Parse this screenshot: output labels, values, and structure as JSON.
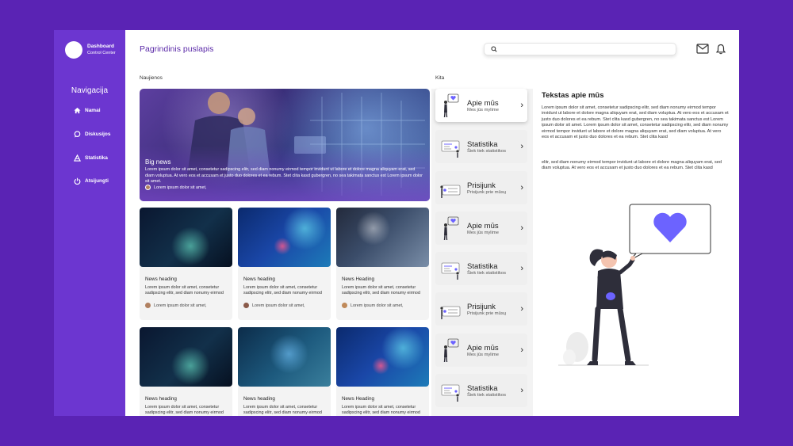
{
  "sidebar": {
    "brand_title": "Dashboard",
    "brand_subtitle": "Control Center",
    "nav_heading": "Navigacija",
    "items": [
      {
        "label": "Namai",
        "icon": "home-icon"
      },
      {
        "label": "Diskusijos",
        "icon": "chat-icon"
      },
      {
        "label": "Statistika",
        "icon": "chart-icon"
      },
      {
        "label": "Atsijungti",
        "icon": "power-icon"
      }
    ]
  },
  "header": {
    "title": "Pagrindinis puslapis",
    "search_placeholder": "",
    "icons": [
      "mail-icon",
      "bell-icon"
    ]
  },
  "news": {
    "section_label": "Naujienos",
    "hero": {
      "title": "Big news",
      "text": "Lorem ipsum dolor sit amet, consetetur sadipscing elitr, sed diam nonumy eirmod tempor invidunt ut labore et dolore magna aliquyam erat, sed diam voluptua. At vero eos et accusam et justo duo dolores et ea rebum. Stet clita kasd gubergren, no sea takimata sanctus est Lorem ipsum dolor sit amet.",
      "author": "Lorem ipsum dolor sit amet,"
    },
    "cards": [
      {
        "heading": "News heading",
        "text": "Lorem ipsum dolor sit amet, consetetur sadipscing elitr, sed diam nonumy eirmod",
        "author": "Lorem ipsum dolor sit amet,"
      },
      {
        "heading": "News heading",
        "text": "Lorem ipsum dolor sit amet, consetetur sadipscing elitr, sed diam nonumy eirmod",
        "author": "Lorem ipsum dolor sit amet,"
      },
      {
        "heading": "News Heading",
        "text": "Lorem ipsum dolor sit amet, consetetur sadipscing elitr, sed diam nonumy eirmod",
        "author": "Lorem ipsum dolor sit amet,"
      },
      {
        "heading": "News heading",
        "text": "Lorem ipsum dolor sit amet, consetetur sadipscing elitr, sed diam nonumy eirmod",
        "author": ""
      },
      {
        "heading": "News heading",
        "text": "Lorem ipsum dolor sit amet, consetetur sadipscing elitr, sed diam nonumy eirmod",
        "author": ""
      },
      {
        "heading": "News Heading",
        "text": "Lorem ipsum dolor sit amet, consetetur sadipscing elitr, sed diam nonumy eirmod",
        "author": ""
      }
    ]
  },
  "kita": {
    "section_label": "Kita",
    "items": [
      {
        "title": "Apie mūs",
        "subtitle": "Mes jūs mylime",
        "active": true
      },
      {
        "title": "Statistika",
        "subtitle": "Šiek tiek statistikos",
        "active": false
      },
      {
        "title": "Prisijunk",
        "subtitle": "Prisijunk prie mūsų",
        "active": false
      },
      {
        "title": "Apie mūs",
        "subtitle": "Mes jūs mylime",
        "active": false
      },
      {
        "title": "Statistika",
        "subtitle": "Šiek tiek statistikos",
        "active": false
      },
      {
        "title": "Prisijunk",
        "subtitle": "Prisijunk prie mūsų",
        "active": false
      },
      {
        "title": "Apie mūs",
        "subtitle": "Mes jūs mylime",
        "active": false
      },
      {
        "title": "Statistika",
        "subtitle": "Šiek tiek statistikos",
        "active": false
      }
    ]
  },
  "about": {
    "title": "Tekstas apie mūs",
    "paragraph1": "Lorem ipsum dolor sit amet, consetetur sadipscing elitr, sed diam nonumy eirmod tempor invidunt ut labore et dolore magna aliquyam erat, sed diam voluptua. At vero eos et accusam et justo duo dolores et ea rebum. Stet clita kasd gubergren, no sea takimata sanctus est Lorem ipsum dolor sit amet. Lorem ipsum dolor sit amet, consetetur sadipscing elitr, sed diam nonumy eirmod tempor invidunt ut labore et dolore magna aliquyam erat, sed diam voluptua. At vero eos et accusam et justo duo dolores et ea rebum. Stet clita kasd",
    "paragraph2": "elitr, sed diam nonumy eirmod tempor invidunt ut labore et dolore magna aliquyam erat, sed diam voluptua. At vero eos et accusam et justo duo dolores et ea rebum. Stet clita kasd"
  },
  "colors": {
    "background": "#5a23b4",
    "sidebar": "#6c36d0",
    "accent": "#6c63ff",
    "title": "#5b2aa8"
  }
}
